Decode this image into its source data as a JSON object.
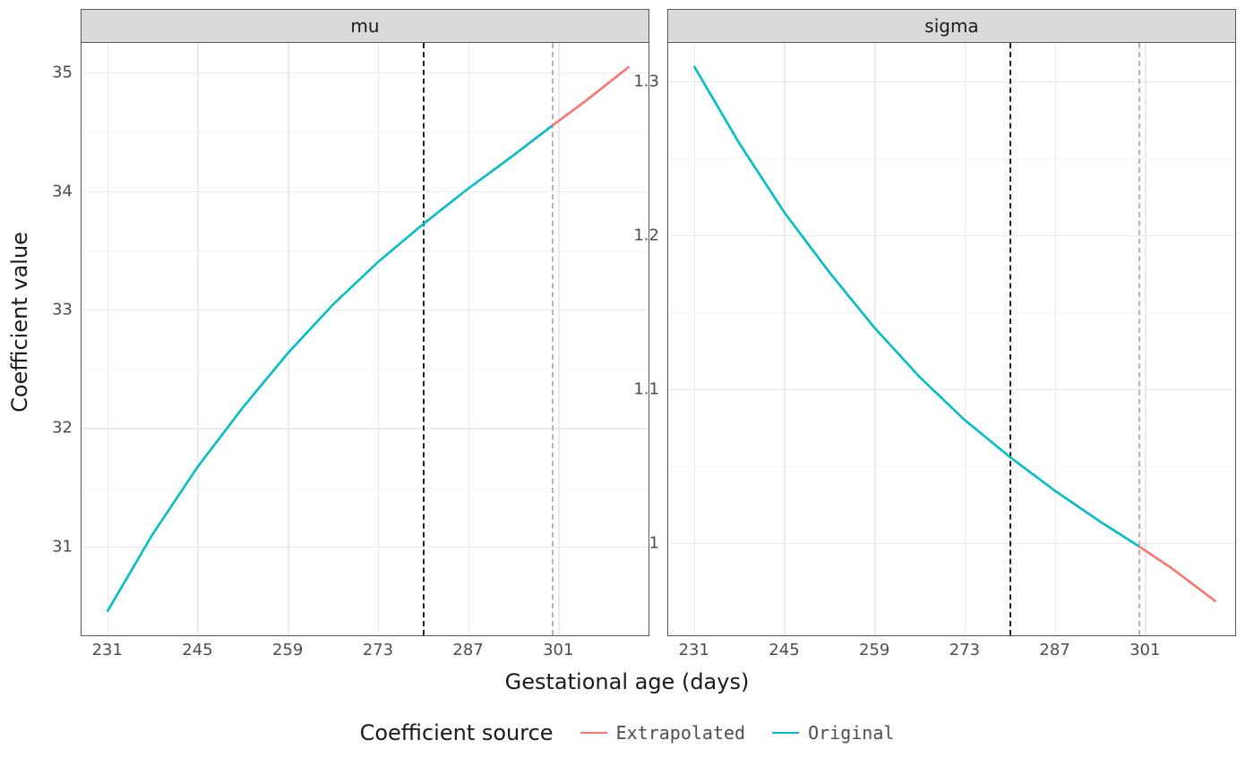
{
  "chart_data": [
    {
      "type": "line",
      "facet": "mu",
      "xlabel": "Gestational age (days)",
      "ylabel": "Coefficient value",
      "xlim": [
        227,
        315
      ],
      "ylim": [
        30.25,
        35.25
      ],
      "xticks": [
        231,
        245,
        259,
        273,
        287,
        301
      ],
      "yticks": [
        31,
        32,
        33,
        34,
        35
      ],
      "vlines": [
        {
          "x": 280,
          "style": "dark"
        },
        {
          "x": 300,
          "style": "light"
        }
      ],
      "series": [
        {
          "name": "Original",
          "color": "#00bfc4",
          "x": [
            231,
            238,
            245,
            252,
            259,
            266,
            273,
            280,
            287,
            294,
            300
          ],
          "values": [
            30.45,
            31.1,
            31.67,
            32.17,
            32.63,
            33.04,
            33.4,
            33.72,
            34.02,
            34.3,
            34.55
          ]
        },
        {
          "name": "Extrapolated",
          "color": "#f8766d",
          "x": [
            300,
            305,
            312
          ],
          "values": [
            34.55,
            34.75,
            35.05
          ]
        }
      ]
    },
    {
      "type": "line",
      "facet": "sigma",
      "xlabel": "Gestational age (days)",
      "ylabel": "Coefficient value",
      "xlim": [
        227,
        315
      ],
      "ylim": [
        0.94,
        1.325
      ],
      "xticks": [
        231,
        245,
        259,
        273,
        287,
        301
      ],
      "yticks": [
        1.0,
        1.1,
        1.2,
        1.3
      ],
      "vlines": [
        {
          "x": 280,
          "style": "dark"
        },
        {
          "x": 300,
          "style": "light"
        }
      ],
      "series": [
        {
          "name": "Original",
          "color": "#00bfc4",
          "x": [
            231,
            238,
            245,
            252,
            259,
            266,
            273,
            280,
            287,
            294,
            300
          ],
          "values": [
            1.31,
            1.26,
            1.215,
            1.176,
            1.14,
            1.108,
            1.08,
            1.056,
            1.034,
            1.014,
            0.998
          ]
        },
        {
          "name": "Extrapolated",
          "color": "#f8766d",
          "x": [
            300,
            305,
            312
          ],
          "values": [
            0.998,
            0.984,
            0.962
          ]
        }
      ]
    }
  ],
  "axis_titles": {
    "x": "Gestational age (days)",
    "y": "Coefficient value"
  },
  "legend": {
    "title": "Coefficient source",
    "items": [
      {
        "label": "Extrapolated",
        "color": "#f8766d"
      },
      {
        "label": "Original",
        "color": "#00bfc4"
      }
    ]
  }
}
